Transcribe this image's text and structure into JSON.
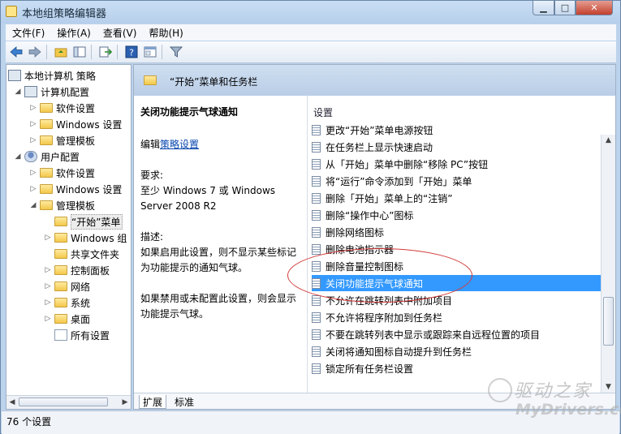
{
  "window": {
    "title": "本地组策略编辑器",
    "buttons": {
      "minimize": "▁",
      "maximize": "□",
      "close": "✕"
    }
  },
  "menu": [
    "文件(F)",
    "操作(A)",
    "查看(V)",
    "帮助(H)"
  ],
  "toolbar": [
    "back-icon",
    "forward-icon",
    "up-folder-icon",
    "show-hide-tree-icon",
    "export-list-icon",
    "help-icon",
    "properties-icon",
    "filter-icon"
  ],
  "tree": {
    "root": "本地计算机 策略",
    "computer": "计算机配置",
    "computer_children": [
      "软件设置",
      "Windows 设置",
      "管理模板"
    ],
    "user": "用户配置",
    "user_children": [
      "软件设置",
      "Windows 设置",
      "管理模板"
    ],
    "admin_children": [
      "“开始”菜单",
      "Windows 组",
      "共享文件夹",
      "控制面板",
      "网络",
      "系统",
      "桌面",
      "所有设置"
    ]
  },
  "header": {
    "title": "“开始”菜单和任务栏"
  },
  "description": {
    "title": "关闭功能提示气球通知",
    "edit_prefix": "编辑",
    "edit_link": "策略设置",
    "req_label": "要求:",
    "req_line1": "至少 Windows 7 或 Windows",
    "req_line2": "Server 2008 R2",
    "desc_label": "描述:",
    "desc_line1": "如果启用此设置，则不显示某些标记",
    "desc_line2": "为功能提示的通知气球。",
    "desc_line3": "如果禁用或未配置此设置，则会显示",
    "desc_line4": "功能提示气球。"
  },
  "list": {
    "column_header": "设置",
    "selected_index": 9,
    "items": [
      "更改“开始”菜单电源按钮",
      "在任务栏上显示快速启动",
      "从「开始」菜单中删除“移除 PC”按钮",
      "将“运行”命令添加到「开始」菜单",
      "删除「开始」菜单上的“注销”",
      "删除“操作中心”图标",
      "删除网络图标",
      "删除电池指示器",
      "删除音量控制图标",
      "关闭功能提示气球通知",
      "不允许在跳转列表中附加项目",
      "不允许将程序附加到任务栏",
      "不要在跳转列表中显示或跟踪来自远程位置的项目",
      "关闭将通知图标自动提升到任务栏",
      "锁定所有任务栏设置"
    ]
  },
  "tabs": [
    "扩展",
    "标准"
  ],
  "status": "76 个设置",
  "watermark": {
    "cn": "驱动之家",
    "en": "MyDrivers.com"
  },
  "colors": {
    "selection": "#3399ff",
    "highlight_ellipse": "#d43b3b",
    "header_band": "#b9cde6"
  }
}
